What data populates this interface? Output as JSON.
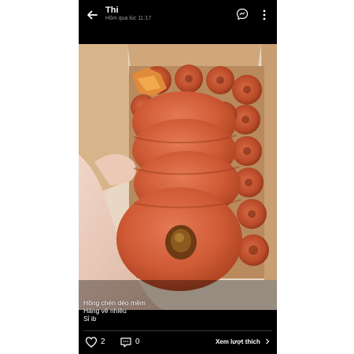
{
  "header": {
    "name": "Thi",
    "timestamp": "Hôm qua lúc 11:17"
  },
  "post": {
    "caption_lines": [
      "Hồng chén dẻo mềm",
      "Hàng về nhiều",
      "Sỉ ib"
    ]
  },
  "actions": {
    "like_count": "2",
    "comment_count": "0",
    "view_likes_label": "Xem lượt thích"
  },
  "colors": {
    "background": "#000000",
    "text": "#ffffff",
    "secondary_text": "#9a9a9a",
    "persimmon": "#d0603c"
  },
  "icons": [
    "back-arrow-icon",
    "message-icon",
    "more-vertical-icon",
    "heart-icon",
    "comment-icon",
    "chevron-right-icon"
  ]
}
